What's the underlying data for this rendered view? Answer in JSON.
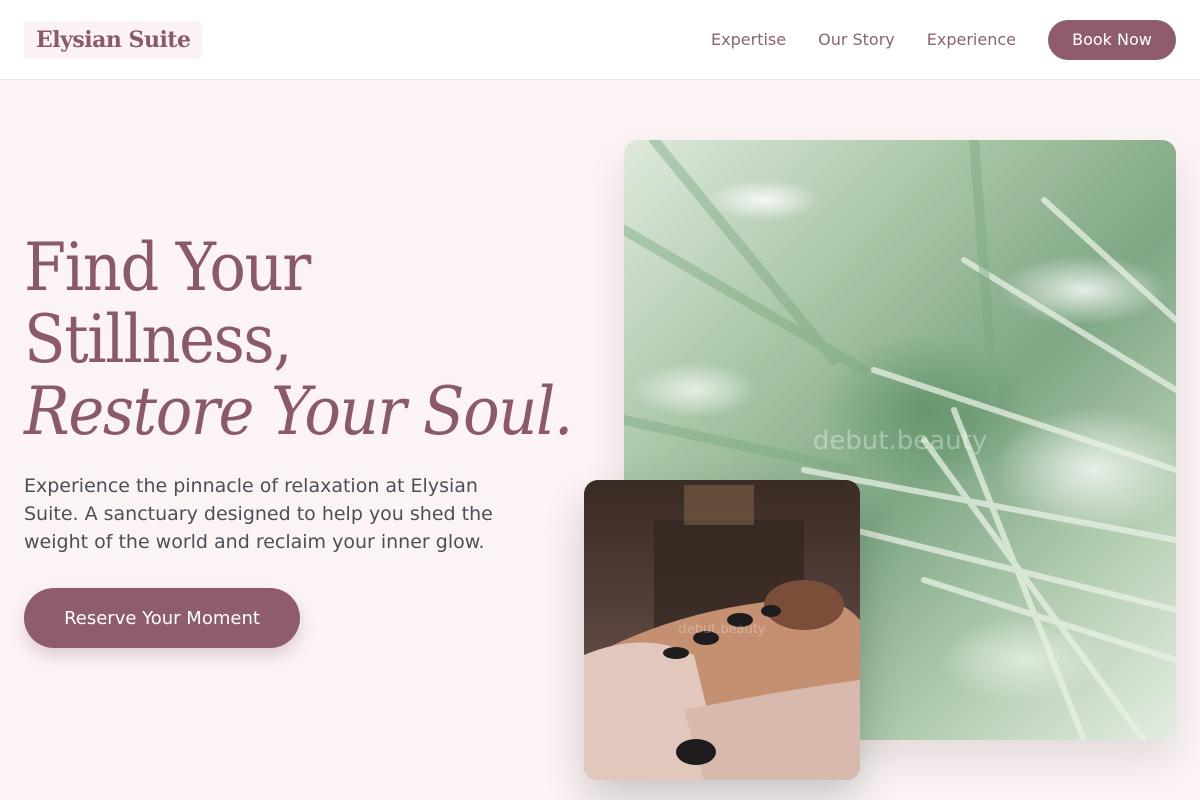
{
  "header": {
    "logo": "Elysian Suite",
    "nav": [
      "Expertise",
      "Our Story",
      "Experience"
    ],
    "book_label": "Book Now"
  },
  "hero": {
    "title_line1": "Find Your",
    "title_line2": "Stillness,",
    "title_line3": "Restore Your Soul.",
    "description": "Experience the pinnacle of relaxation at Elysian Suite. A sanctuary designed to help you shed the weight of the world and reclaim your inner glow.",
    "cta_label": "Reserve Your Moment"
  },
  "images": {
    "large_watermark": "debut.beauty",
    "small_watermark": "debut.beauty"
  },
  "colors": {
    "brand": "#8e5c6b",
    "background": "#fcf4f4",
    "text_body": "#4b4e5a"
  }
}
